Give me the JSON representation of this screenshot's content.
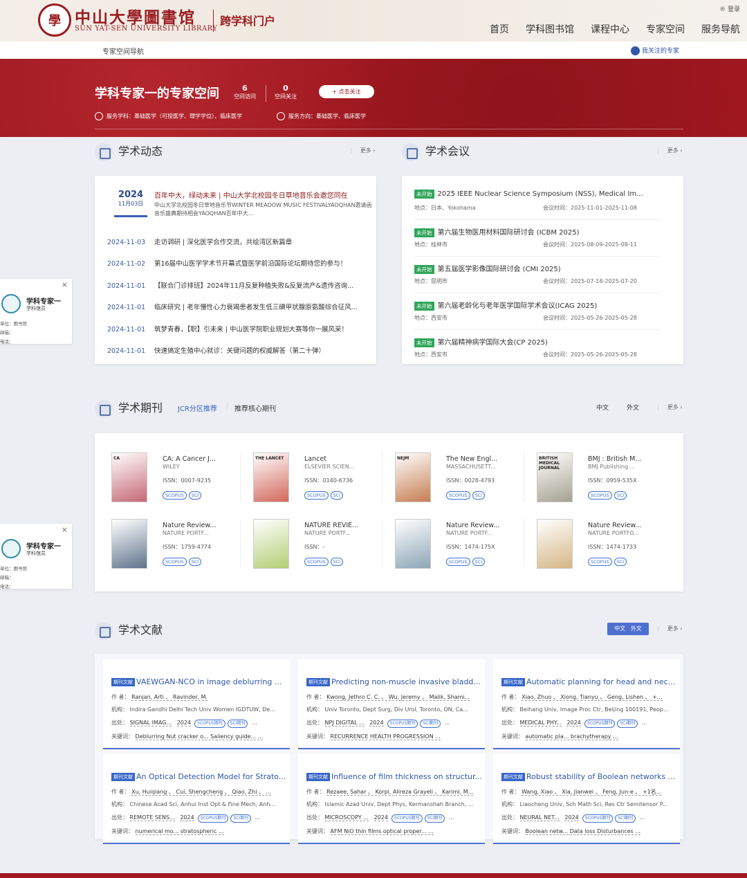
{
  "header": {
    "seal_char": "學",
    "lib_name_cn": "中山大學圖書馆",
    "lib_name_en": "SUN YAT-SEN UNIVERSITY LIBRARY",
    "portal": "跨学科门户",
    "login": "® 登录",
    "nav": [
      "首页",
      "学科图书馆",
      "课程中心",
      "专家空间",
      "服务导航"
    ]
  },
  "subbar": {
    "title": "专家空间导航",
    "follow": "我关注的专家"
  },
  "banner": {
    "title": "学科专家一的专家空间",
    "visits": "6",
    "visits_label": "空间访问",
    "follows": "0",
    "follows_label": "空间关注",
    "follow_btn": "+ 点击关注",
    "subjects": "服务学科：基础医学（可授医学、理学学位）、临床医学",
    "directions": "服务方向：基础医学、临床医学"
  },
  "more": "更多 ›",
  "news": {
    "title": "学术动态",
    "featured": {
      "year": "2024",
      "md": "11月03日",
      "title": "百年中大，绿动未来 | 中山大学北校园冬日草地音乐会邀您同在",
      "desc": "中山大学北校园冬日草地音乐节WINTER MEADOW MUSIC FESTIVALYAOQHAN邀请函音乐盛典期待相会YAOQHAN百年中大..."
    },
    "items": [
      {
        "date": "2024-11-03",
        "title": "走访调研 | 深化医学合作交流，共绘湾区新篇章"
      },
      {
        "date": "2024-11-02",
        "title": "第16届中山医学学术节开幕式暨医学前沿国际论坛期待您的参与！"
      },
      {
        "date": "2024-11-01",
        "title": "【联合门诊排班】2024年11月反复种植失败&反复流产&遗传咨询..."
      },
      {
        "date": "2024-11-01",
        "title": "临床研究 | 老年慢性心力衰竭患者发生低三碘甲状腺原氨酸综合征风..."
      },
      {
        "date": "2024-11-01",
        "title": "筑梦青春，【职】引未来 | 中山医学院职业规划大赛等你一展风采！"
      },
      {
        "date": "2024-11-01",
        "title": "快速搞定生殖中心就诊：关键问题的权威解答（第二十弹）"
      }
    ]
  },
  "conf": {
    "title": "学术会议",
    "tag": "未开始",
    "items": [
      {
        "title": "2025 IEEE Nuclear Science Symposium (NSS), Medical Im...",
        "loc": "地点：日本、Yokohama",
        "time": "会议时间：2025-11-01-2025-11-08"
      },
      {
        "title": "第六届生物医用材料国际研讨会 (ICBM 2025)",
        "loc": "地点：桂林市",
        "time": "会议时间：2025-08-09-2025-08-11"
      },
      {
        "title": "第五届医学影像国际研讨会 (CMI 2025)",
        "loc": "地点：昆明市",
        "time": "会议时间：2025-07-18-2025-07-20"
      },
      {
        "title": "第六届老龄化与老年医学国际学术会议(ICAG 2025)",
        "loc": "地点：西安市",
        "time": "会议时间：2025-05-26-2025-05-28"
      },
      {
        "title": "第六届精神病学国际大会(CP 2025)",
        "loc": "地点：西安市",
        "time": "会议时间：2025-05-26-2025-05-28"
      }
    ]
  },
  "journals": {
    "title": "学术期刊",
    "tab_jcr": "JCR分区推荐",
    "tab_core": "推荐核心期刊",
    "lang_cn": "中文",
    "lang_en": "外文",
    "items": [
      {
        "name": "CA: A Cancer J...",
        "pub": "WILEY",
        "issn": "ISSN：0007-9235",
        "cover": "CA",
        "color": "#b43a4b"
      },
      {
        "name": "Lancet",
        "pub": "ELSEVIER SCIEN...",
        "issn": "ISSN：0140-6736",
        "cover": "THE LANCET",
        "color": "#c53a2a"
      },
      {
        "name": "The New Engl...",
        "pub": "MASSACHUSETT...",
        "issn": "ISSN：0028-4793",
        "cover": "NEJM",
        "color": "#b4571e"
      },
      {
        "name": "BMJ : British M...",
        "pub": "BMJ Publishing ...",
        "issn": "ISSN：0959-535X",
        "cover": "BRITISH MEDICAL JOURNAL",
        "color": "#8a8570"
      },
      {
        "name": "Nature Review...",
        "pub": "NATURE PORTF...",
        "issn": "ISSN：1759-4774",
        "cover": "",
        "color": "#2f4a6a"
      },
      {
        "name": "NATURE REVIE...",
        "pub": "NATURE PORTF...",
        "issn": "ISSN：-",
        "cover": "",
        "color": "#9ac04a"
      },
      {
        "name": "Nature Review...",
        "pub": "NATURE PORTF...",
        "issn": "ISSN：1474-175X",
        "cover": "",
        "color": "#6a8aa0"
      },
      {
        "name": "Nature Review...",
        "pub": "NATURE PORTFO...",
        "issn": "ISSN：1474-1733",
        "cover": "",
        "color": "#c8a060"
      }
    ]
  },
  "lit": {
    "title": "学术文献",
    "lang_cn": "中文",
    "lang_en": "外文",
    "tag": "期刊文献",
    "lbl_author": "作 者：",
    "lbl_org": "机构：",
    "lbl_src": "出处：",
    "lbl_kw": "关键词：",
    "items": [
      {
        "title": "VAEWGAN-NCO in image deblurring ...",
        "authors": "Ranjan, Arti 、 Ravinder, M.",
        "org": "Indira Gandhi Delhi Tech Univ Women IGDTUW, De...",
        "src": "SIGNAL IMAG...",
        "year": "2024",
        "kw": "Deblurring   Nut cracker o...   Saliency guide...   ..."
      },
      {
        "title": "Predicting non-muscle invasive bladd...",
        "authors": "Kwong, Jethro C. C. 、 Wu, Jeremy 、 Malik, Shami...",
        "org": "Univ Toronto, Dept Surg, Div Urol, Toronto, ON, Ca...",
        "src": "NPJ DIGITAL ...",
        "year": "2024",
        "kw": "RECURRENCE   HEALTH   PROGRESSION   ..."
      },
      {
        "title": "Automatic planning for head and nec...",
        "authors": "Xiao, Zhuo 、 Xiong, Tianyu 、 Geng, Lishen 、 +...",
        "org": "Beihang Univ, Image Proc Ctr, Beijing 100191, Peop...",
        "src": "MEDICAL PHY...",
        "year": "2024",
        "kw": "automatic pla...   brachytherapy   ..."
      },
      {
        "title": "An Optical Detection Model for Strato...",
        "authors": "Xu, Huiqiang 、 Cui, Shengcheng 、 Qiao, Zhi 、 ...",
        "org": "Chinese Acad Sci, Anhui Inst Opt & Fine Mech, Anh...",
        "src": "REMOTE SENS...",
        "year": "2024",
        "kw": "numerical mo...   stratospheric   ..."
      },
      {
        "title": "Influence of film thickness on structur...",
        "authors": "Rezaee, Sahar 、 Korpi, Alireza Grayeli 、 Karimi, M...",
        "org": "Islamic Azad Univ, Dept Phys, Kermanshah Branch, ...",
        "src": "MICROSCOPY ...",
        "year": "2024",
        "kw": "AFM   NiO thin films   optical proper...   ..."
      },
      {
        "title": "Robust stability of Boolean networks ...",
        "authors": "Wang, Xiao 、 Xia, Jianwei 、 Feng, Jun-e 、 +1名...",
        "org": "Liaocheng Univ, Sch Math Sci, Res Ctr Semitensor P...",
        "src": "NEURAL NET...",
        "year": "2024",
        "kw": "Boolean netw...   Data loss   Disturbances   ..."
      }
    ]
  },
  "sidecard": {
    "name": "学科专家一",
    "role": "学科馆员",
    "unit": "单位：图书馆",
    "email": "邮箱：",
    "phone": "电话：",
    "close": "×"
  },
  "colors": {
    "brand": "#a01820",
    "accent": "#3565c8"
  }
}
